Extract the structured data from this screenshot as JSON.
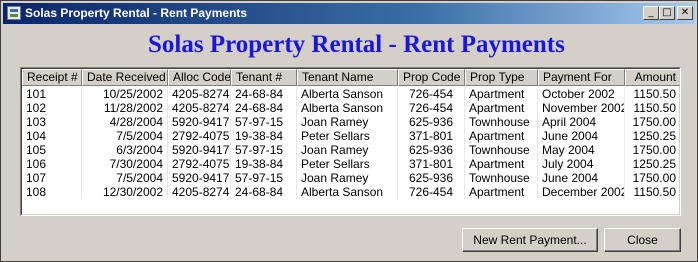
{
  "window": {
    "title": "Solas Property Rental - Rent Payments",
    "controls": {
      "minimize": "_",
      "maximize": "□",
      "close": "✕"
    }
  },
  "heading": "Solas Property Rental - Rent Payments",
  "table": {
    "columns": [
      "Receipt #",
      "Date Received",
      "Alloc Code",
      "Tenant #",
      "Tenant Name",
      "Prop Code",
      "Prop Type",
      "Payment For",
      "Amount"
    ],
    "rows": [
      [
        "101",
        "10/25/2002",
        "4205-8274",
        "24-68-84",
        "Alberta Sanson",
        "726-454",
        "Apartment",
        "October 2002",
        "1150.50"
      ],
      [
        "102",
        "11/28/2002",
        "4205-8274",
        "24-68-84",
        "Alberta Sanson",
        "726-454",
        "Apartment",
        "November 2002",
        "1150.50"
      ],
      [
        "103",
        "4/28/2004",
        "5920-9417",
        "57-97-15",
        "Joan Ramey",
        "625-936",
        "Townhouse",
        "April 2004",
        "1750.00"
      ],
      [
        "104",
        "7/5/2004",
        "2792-4075",
        "19-38-84",
        "Peter Sellars",
        "371-801",
        "Apartment",
        "June 2004",
        "1250.25"
      ],
      [
        "105",
        "6/3/2004",
        "5920-9417",
        "57-97-15",
        "Joan Ramey",
        "625-936",
        "Townhouse",
        "May 2004",
        "1750.00"
      ],
      [
        "106",
        "7/30/2004",
        "2792-4075",
        "19-38-84",
        "Peter Sellars",
        "371-801",
        "Apartment",
        "July 2004",
        "1250.25"
      ],
      [
        "107",
        "7/5/2004",
        "5920-9417",
        "57-97-15",
        "Joan Ramey",
        "625-936",
        "Townhouse",
        "June 2004",
        "1750.00"
      ],
      [
        "108",
        "12/30/2002",
        "4205-8274",
        "24-68-84",
        "Alberta Sanson",
        "726-454",
        "Apartment",
        "December 2002",
        "1150.50"
      ]
    ]
  },
  "buttons": {
    "new_payment": "New Rent Payment...",
    "close": "Close"
  }
}
